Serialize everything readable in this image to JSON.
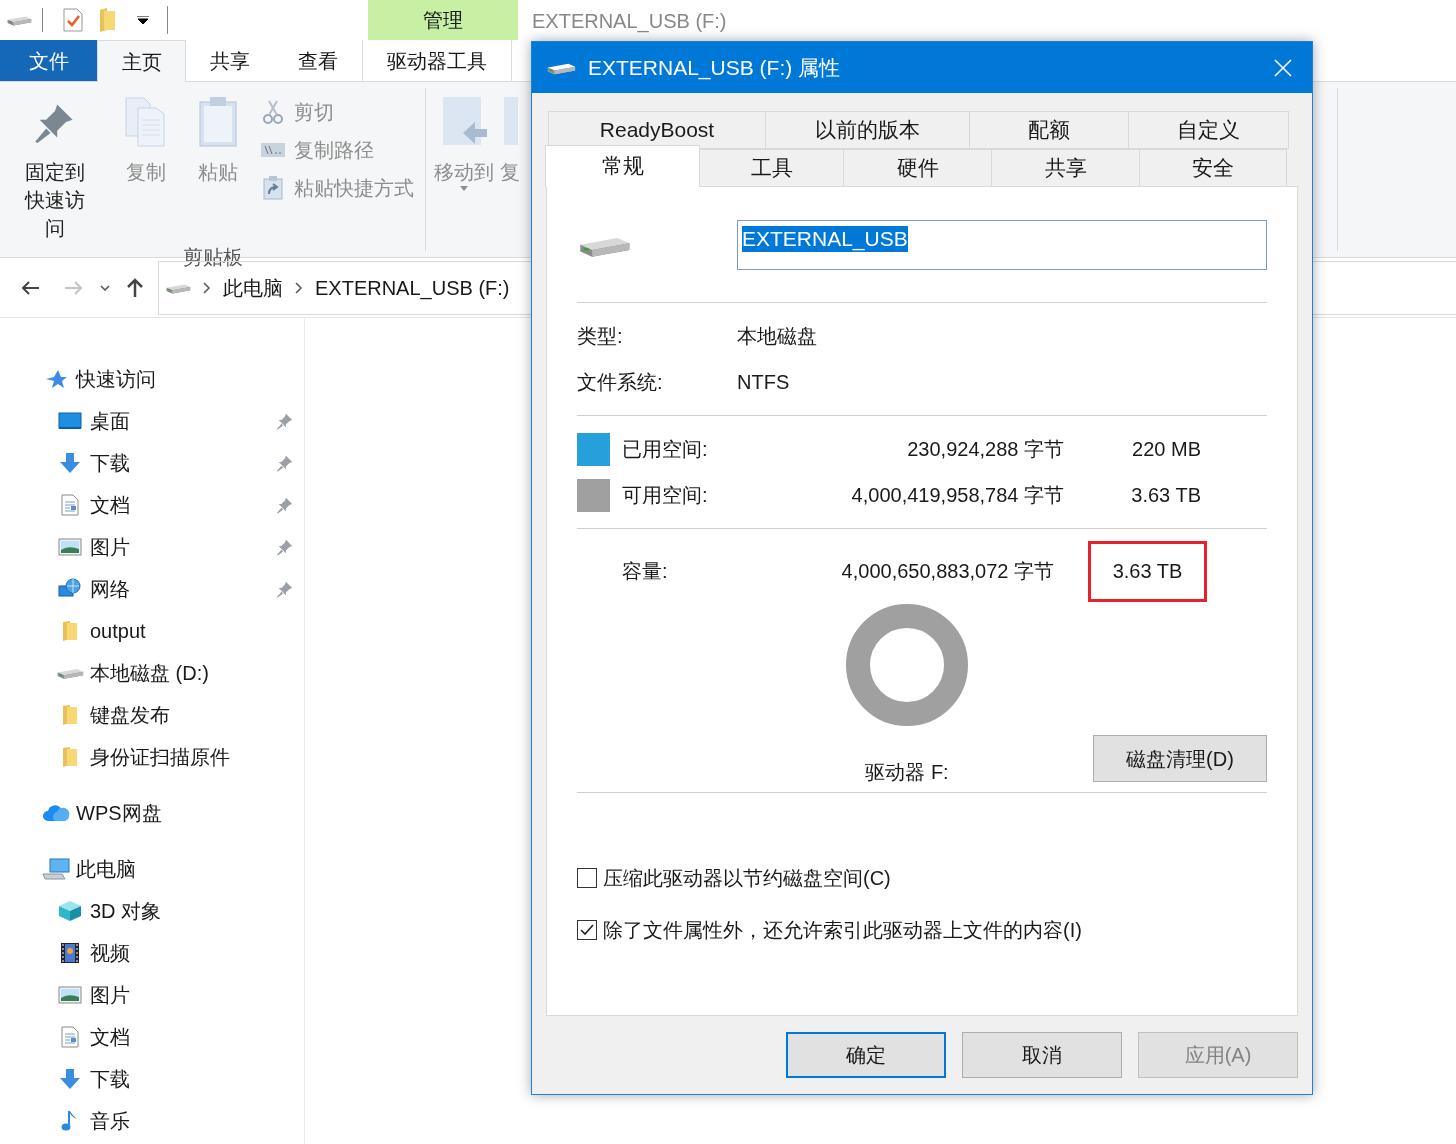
{
  "explorer": {
    "context_tab_group": "管理",
    "ribbon_tabs": [
      {
        "label": "文件",
        "kind": "file",
        "selected": false
      },
      {
        "label": "主页",
        "kind": "tab",
        "selected": true
      },
      {
        "label": "共享",
        "kind": "tab",
        "selected": false
      },
      {
        "label": "查看",
        "kind": "tab",
        "selected": false
      },
      {
        "label": "驱动器工具",
        "kind": "tab",
        "selected": false
      }
    ],
    "ribbon": {
      "large_buttons": [
        {
          "label": "固定到快速访问",
          "kind": "pin",
          "disabled": false
        },
        {
          "label": "复制",
          "kind": "copy",
          "disabled": true
        },
        {
          "label": "粘贴",
          "kind": "paste",
          "disabled": true
        }
      ],
      "small_buttons": [
        {
          "label": "剪切",
          "kind": "cut",
          "disabled": true
        },
        {
          "label": "复制路径",
          "kind": "path",
          "disabled": true
        },
        {
          "label": "粘贴快捷方式",
          "kind": "shortcut",
          "disabled": true
        }
      ],
      "group_label": "剪贴板",
      "organize_buttons": [
        {
          "label": "移动到",
          "kind": "move",
          "disabled": true
        },
        {
          "label": "复",
          "kind": "copyto",
          "disabled": true
        }
      ]
    },
    "breadcrumb": [
      "此电脑",
      "EXTERNAL_USB (F:)"
    ],
    "nav": [
      {
        "label": "快速访问",
        "kind": "star",
        "children": [
          {
            "label": "桌面",
            "kind": "desktop",
            "pinned": true
          },
          {
            "label": "下载",
            "kind": "download",
            "pinned": true
          },
          {
            "label": "文档",
            "kind": "document",
            "pinned": true
          },
          {
            "label": "图片",
            "kind": "pictures",
            "pinned": true
          },
          {
            "label": "网络",
            "kind": "network",
            "pinned": true
          },
          {
            "label": "output",
            "kind": "folder",
            "pinned": false
          },
          {
            "label": "本地磁盘 (D:)",
            "kind": "drive",
            "pinned": false
          },
          {
            "label": "键盘发布",
            "kind": "folder",
            "pinned": false
          },
          {
            "label": "身份证扫描原件",
            "kind": "folder",
            "pinned": false
          }
        ]
      },
      {
        "label": "WPS网盘",
        "kind": "cloud"
      },
      {
        "label": "此电脑",
        "kind": "computer",
        "children": [
          {
            "label": "3D 对象",
            "kind": "cube",
            "pinned": false
          },
          {
            "label": "视频",
            "kind": "video",
            "pinned": false
          },
          {
            "label": "图片",
            "kind": "pictures",
            "pinned": false
          },
          {
            "label": "文档",
            "kind": "document",
            "pinned": false
          },
          {
            "label": "下载",
            "kind": "download",
            "pinned": false
          },
          {
            "label": "音乐",
            "kind": "music",
            "pinned": false
          }
        ]
      }
    ],
    "background_title": "EXTERNAL_USB (F:)"
  },
  "dialog": {
    "title": "EXTERNAL_USB (F:) 属性",
    "tab_rows": [
      [
        {
          "label": "ReadyBoost",
          "selected": false
        },
        {
          "label": "以前的版本",
          "selected": false
        },
        {
          "label": "配额",
          "selected": false
        },
        {
          "label": "自定义",
          "selected": false
        }
      ],
      [
        {
          "label": "常规",
          "selected": true
        },
        {
          "label": "工具",
          "selected": false
        },
        {
          "label": "硬件",
          "selected": false
        },
        {
          "label": "共享",
          "selected": false
        },
        {
          "label": "安全",
          "selected": false
        }
      ]
    ],
    "name_field": {
      "value": "EXTERNAL_USB",
      "text_selected": true
    },
    "info": [
      {
        "label": "类型:",
        "value": "本地磁盘"
      },
      {
        "label": "文件系统:",
        "value": "NTFS"
      }
    ],
    "space": [
      {
        "label": "已用空间:",
        "bytes": "230,924,288 字节",
        "size": "220 MB",
        "color": "#26a0da"
      },
      {
        "label": "可用空间:",
        "bytes": "4,000,419,958,784 字节",
        "size": "3.63 TB",
        "color": "#a0a0a0"
      }
    ],
    "capacity": {
      "label": "容量:",
      "bytes": "4,000,650,883,072 字节",
      "size": "3.63 TB",
      "highlighted": true
    },
    "drive_label": "驱动器 F:",
    "cleanup_button": "磁盘清理(D)",
    "options": [
      {
        "label": "压缩此驱动器以节约磁盘空间(C)",
        "checked": false
      },
      {
        "label": "除了文件属性外，还允许索引此驱动器上文件的内容(I)",
        "checked": true
      }
    ],
    "buttons": [
      {
        "label": "确定",
        "kind": "default",
        "disabled": false
      },
      {
        "label": "取消",
        "kind": "normal",
        "disabled": false
      },
      {
        "label": "应用(A)",
        "kind": "normal",
        "disabled": true
      }
    ]
  }
}
